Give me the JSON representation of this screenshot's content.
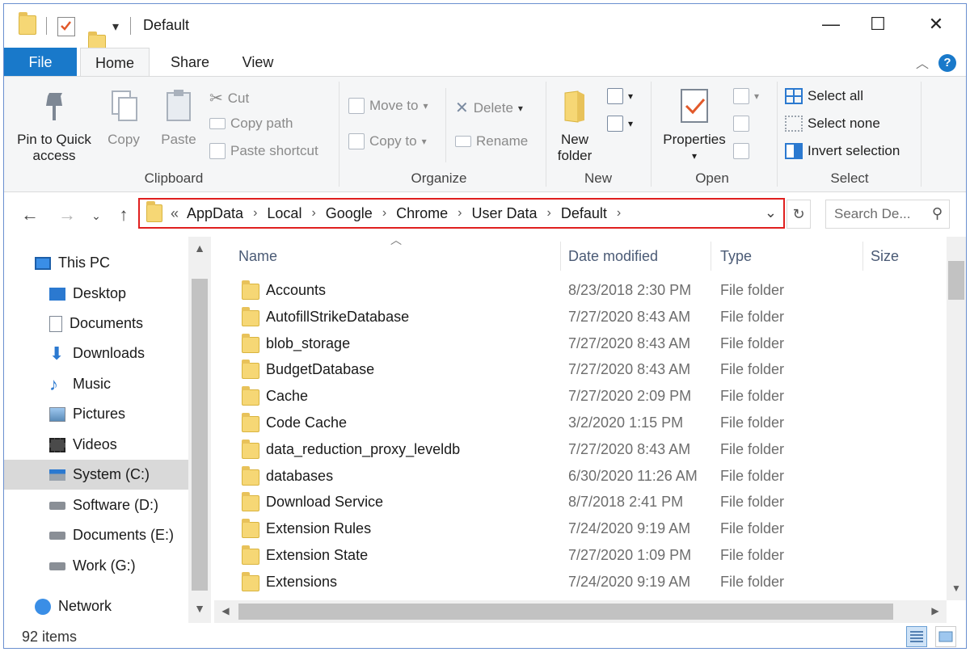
{
  "window": {
    "title": "Default",
    "controls": {
      "minimize": "—",
      "maximize": "☐",
      "close": "✕"
    }
  },
  "tabs": [
    "File",
    "Home",
    "Share",
    "View"
  ],
  "help_label": "?",
  "ribbon": {
    "clipboard": {
      "group_label": "Clipboard",
      "pin_label_1": "Pin to Quick",
      "pin_label_2": "access",
      "copy_label": "Copy",
      "paste_label": "Paste",
      "cut_label": "Cut",
      "copy_path_label": "Copy path",
      "paste_shortcut_label": "Paste shortcut"
    },
    "organize": {
      "group_label": "Organize",
      "move_to_label": "Move to",
      "copy_to_label": "Copy to",
      "delete_label": "Delete",
      "rename_label": "Rename"
    },
    "new": {
      "group_label": "New",
      "new_folder_label_1": "New",
      "new_folder_label_2": "folder"
    },
    "open": {
      "group_label": "Open",
      "properties_label": "Properties"
    },
    "select": {
      "group_label": "Select",
      "select_all_label": "Select all",
      "select_none_label": "Select none",
      "invert_selection_label": "Invert selection"
    }
  },
  "address": {
    "prefix": "«",
    "crumbs": [
      "AppData",
      "Local",
      "Google",
      "Chrome",
      "User Data",
      "Default"
    ]
  },
  "search": {
    "placeholder": "Search De..."
  },
  "nav": {
    "items": [
      {
        "label": "This PC",
        "icon": "monitor-icon"
      },
      {
        "label": "Desktop",
        "icon": "desktop-icon"
      },
      {
        "label": "Documents",
        "icon": "document-icon"
      },
      {
        "label": "Downloads",
        "icon": "download-arrow-icon"
      },
      {
        "label": "Music",
        "icon": "music-note-icon"
      },
      {
        "label": "Pictures",
        "icon": "picture-icon"
      },
      {
        "label": "Videos",
        "icon": "film-icon"
      },
      {
        "label": "System (C:)",
        "icon": "system-drive-icon"
      },
      {
        "label": "Software (D:)",
        "icon": "drive-icon"
      },
      {
        "label": "Documents (E:)",
        "icon": "drive-icon"
      },
      {
        "label": "Work (G:)",
        "icon": "drive-icon"
      },
      {
        "label": "Network",
        "icon": "network-icon"
      }
    ],
    "selected": "System (C:)"
  },
  "columns": {
    "name": "Name",
    "date": "Date modified",
    "type": "Type",
    "size": "Size"
  },
  "files": [
    {
      "name": "Accounts",
      "date": "8/23/2018 2:30 PM",
      "type": "File folder"
    },
    {
      "name": "AutofillStrikeDatabase",
      "date": "7/27/2020 8:43 AM",
      "type": "File folder"
    },
    {
      "name": "blob_storage",
      "date": "7/27/2020 8:43 AM",
      "type": "File folder"
    },
    {
      "name": "BudgetDatabase",
      "date": "7/27/2020 8:43 AM",
      "type": "File folder"
    },
    {
      "name": "Cache",
      "date": "7/27/2020 2:09 PM",
      "type": "File folder"
    },
    {
      "name": "Code Cache",
      "date": "3/2/2020 1:15 PM",
      "type": "File folder"
    },
    {
      "name": "data_reduction_proxy_leveldb",
      "date": "7/27/2020 8:43 AM",
      "type": "File folder"
    },
    {
      "name": "databases",
      "date": "6/30/2020 11:26 AM",
      "type": "File folder"
    },
    {
      "name": "Download Service",
      "date": "8/7/2018 2:41 PM",
      "type": "File folder"
    },
    {
      "name": "Extension Rules",
      "date": "7/24/2020 9:19 AM",
      "type": "File folder"
    },
    {
      "name": "Extension State",
      "date": "7/27/2020 1:09 PM",
      "type": "File folder"
    },
    {
      "name": "Extensions",
      "date": "7/24/2020 9:19 AM",
      "type": "File folder"
    }
  ],
  "status": {
    "item_count": "92 items"
  },
  "colors": {
    "accent": "#1979ca",
    "highlight_border": "#e0201f",
    "folder": "#f6d775"
  }
}
